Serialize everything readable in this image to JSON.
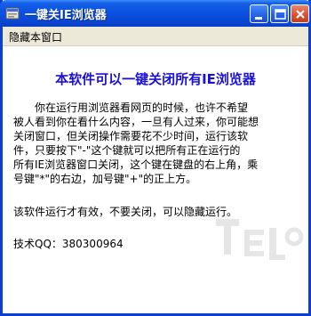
{
  "window": {
    "title": "一键关IE浏览器",
    "icon": "app-icon"
  },
  "titlebar_buttons": {
    "minimize_icon": "minimize-icon",
    "maximize_icon": "maximize-icon",
    "close_icon": "close-icon"
  },
  "menu": {
    "hide_label": "隐藏本窗口"
  },
  "content": {
    "heading": "本软件可以一键关闭所有IE浏览器",
    "paragraph_lines": [
      "你在运行用浏览器看网页的时候，也许不希望",
      "被人看到你在看什么内容，一旦有人过来，你可能想",
      "关闭窗口，但关闭操作需要花不少时间，运行该软",
      "件，只要按下\"-\"这个键就可以把所有正在运行的",
      "所有IE浏览器窗口关闭，这个键在键盘的右上角，乘",
      "号键\"*\"的右边，加号键\"+\"的正上方。"
    ],
    "note": "该软件运行才有效，不要关闭，可以隐藏运行。",
    "qq": "技术QQ：380300964"
  },
  "colors": {
    "title_bar": "#0a48d6",
    "heading": "#1a10d8",
    "menu_bar": "#ece9d8"
  }
}
